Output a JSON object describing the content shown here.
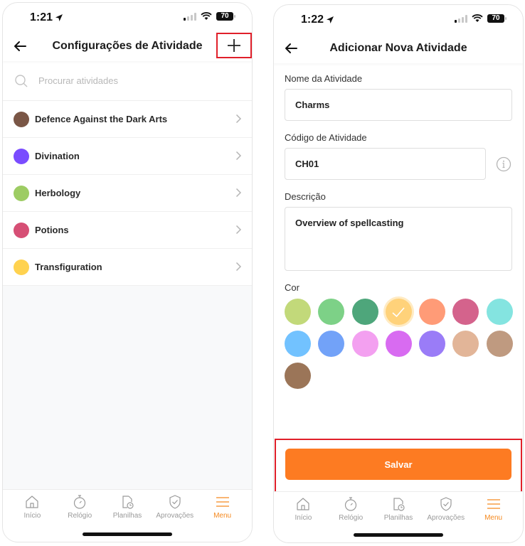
{
  "left_screen": {
    "status": {
      "time": "1:21",
      "battery": "70"
    },
    "nav": {
      "title": "Configurações de Atividade"
    },
    "search": {
      "placeholder": "Procurar atividades"
    },
    "activities": [
      {
        "name": "Defence Against the Dark Arts",
        "color": "#7a5646"
      },
      {
        "name": "Divination",
        "color": "#7a4cff"
      },
      {
        "name": "Herbology",
        "color": "#9dcc63"
      },
      {
        "name": "Potions",
        "color": "#d64f75"
      },
      {
        "name": "Transfiguration",
        "color": "#ffd24f"
      }
    ]
  },
  "right_screen": {
    "status": {
      "time": "1:22",
      "battery": "70"
    },
    "nav": {
      "title": "Adicionar Nova Atividade"
    },
    "form": {
      "name_label": "Nome da Atividade",
      "name_value": "Charms",
      "code_label": "Código de Atividade",
      "code_value": "CH01",
      "description_label": "Descrição",
      "description_value": "Overview of spellcasting",
      "color_label": "Cor",
      "colors": [
        "#c2d97a",
        "#7dd187",
        "#4ea67b",
        "#ffd27a",
        "#ff9b77",
        "#d4638c",
        "#84e4e0",
        "#72c2ff",
        "#72a2f8",
        "#f3a0f0",
        "#d86bf1",
        "#9a7cf7",
        "#e2b598",
        "#bf9a80",
        "#9b7558"
      ],
      "selected_color_index": 3
    },
    "save_label": "Salvar"
  },
  "tab_bar": {
    "tabs": [
      {
        "label": "Início",
        "icon": "home-icon"
      },
      {
        "label": "Relógio",
        "icon": "stopwatch-icon"
      },
      {
        "label": "Planilhas",
        "icon": "timesheet-icon"
      },
      {
        "label": "Aprovações",
        "icon": "shield-check-icon"
      },
      {
        "label": "Menu",
        "icon": "menu-icon"
      }
    ],
    "active_index": 4,
    "active_color": "#f5891f"
  }
}
